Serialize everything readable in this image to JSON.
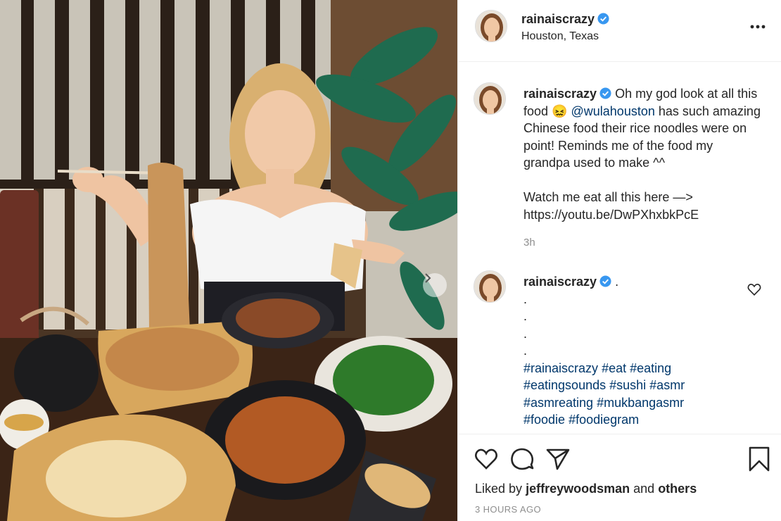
{
  "post": {
    "username": "rainaiscrazy",
    "location": "Houston, Texas",
    "colors": {
      "link": "#00376b",
      "verified": "#3897f0",
      "muted": "#8e8e8e"
    }
  },
  "caption": {
    "username": "rainaiscrazy",
    "text_1": "Oh my god look at all this food",
    "emoji": "😖",
    "mention": "@wulahouston",
    "text_2": "has such amazing Chinese food their rice noodles were on point! Reminds me of the food my grandpa used to make ^^",
    "watch": "Watch me eat all this here —>",
    "link": "https://youtu.be/DwPXhxbkPcE",
    "time": "3h"
  },
  "comment": {
    "username": "rainaiscrazy",
    "dot": ".",
    "dots": [
      ".",
      ".",
      ".",
      "."
    ],
    "hashtags": [
      "#rainaiscrazy",
      "#eat",
      "#eating",
      "#eatingsounds",
      "#sushi",
      "#asmr",
      "#asmreating",
      "#mukbangasmr",
      "#foodie",
      "#foodiegram"
    ]
  },
  "footer": {
    "liked_prefix": "Liked by",
    "liked_user": "jeffreywoodsman",
    "liked_and": "and",
    "liked_others": "others",
    "timestamp": "3 HOURS AGO"
  },
  "icons": [
    "verified-badge-icon",
    "more-options-icon",
    "like-icon",
    "comment-icon",
    "share-icon",
    "save-icon",
    "comment-like-icon",
    "next-arrow-icon"
  ]
}
